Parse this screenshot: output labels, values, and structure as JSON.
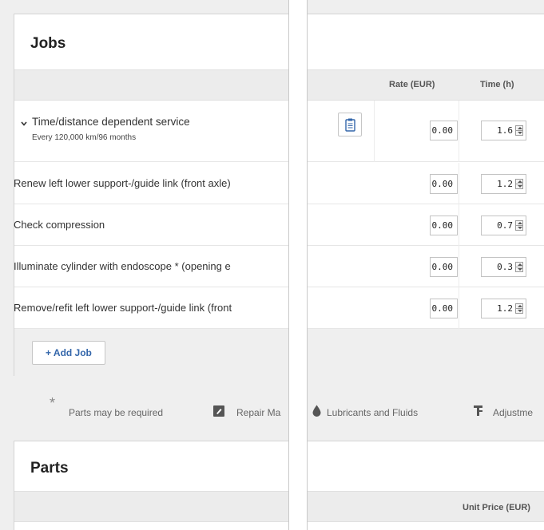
{
  "jobs": {
    "title": "Jobs",
    "columns": {
      "rate": "Rate (EUR)",
      "time": "Time (h)"
    },
    "rows": [
      {
        "name": "Time/distance dependent service",
        "sub": "Every 120,000 km/96 months",
        "rate": "0.00",
        "time": "1.6",
        "expandable": true
      },
      {
        "name": "Renew left lower support-/guide link (front axle)",
        "rate": "0.00",
        "time": "1.2"
      },
      {
        "name": "Check compression",
        "rate": "0.00",
        "time": "0.7"
      },
      {
        "name": "Illuminate cylinder with endoscope * (opening e",
        "rate": "0.00",
        "time": "0.3"
      },
      {
        "name": "Remove/refit left lower support-/guide link (front",
        "rate": "0.00",
        "time": "1.2"
      }
    ],
    "add_label": "+ Add Job"
  },
  "legend": {
    "parts_required": "Parts may be required",
    "repair_manual": "Repair Ma",
    "lubricants": "Lubricants and Fluids",
    "adjustments": "Adjustme"
  },
  "parts": {
    "title": "Parts",
    "columns": {
      "unit_price": "Unit Price (EUR)"
    }
  },
  "colors": {
    "link": "#3366aa",
    "header_bg": "#ececec"
  }
}
